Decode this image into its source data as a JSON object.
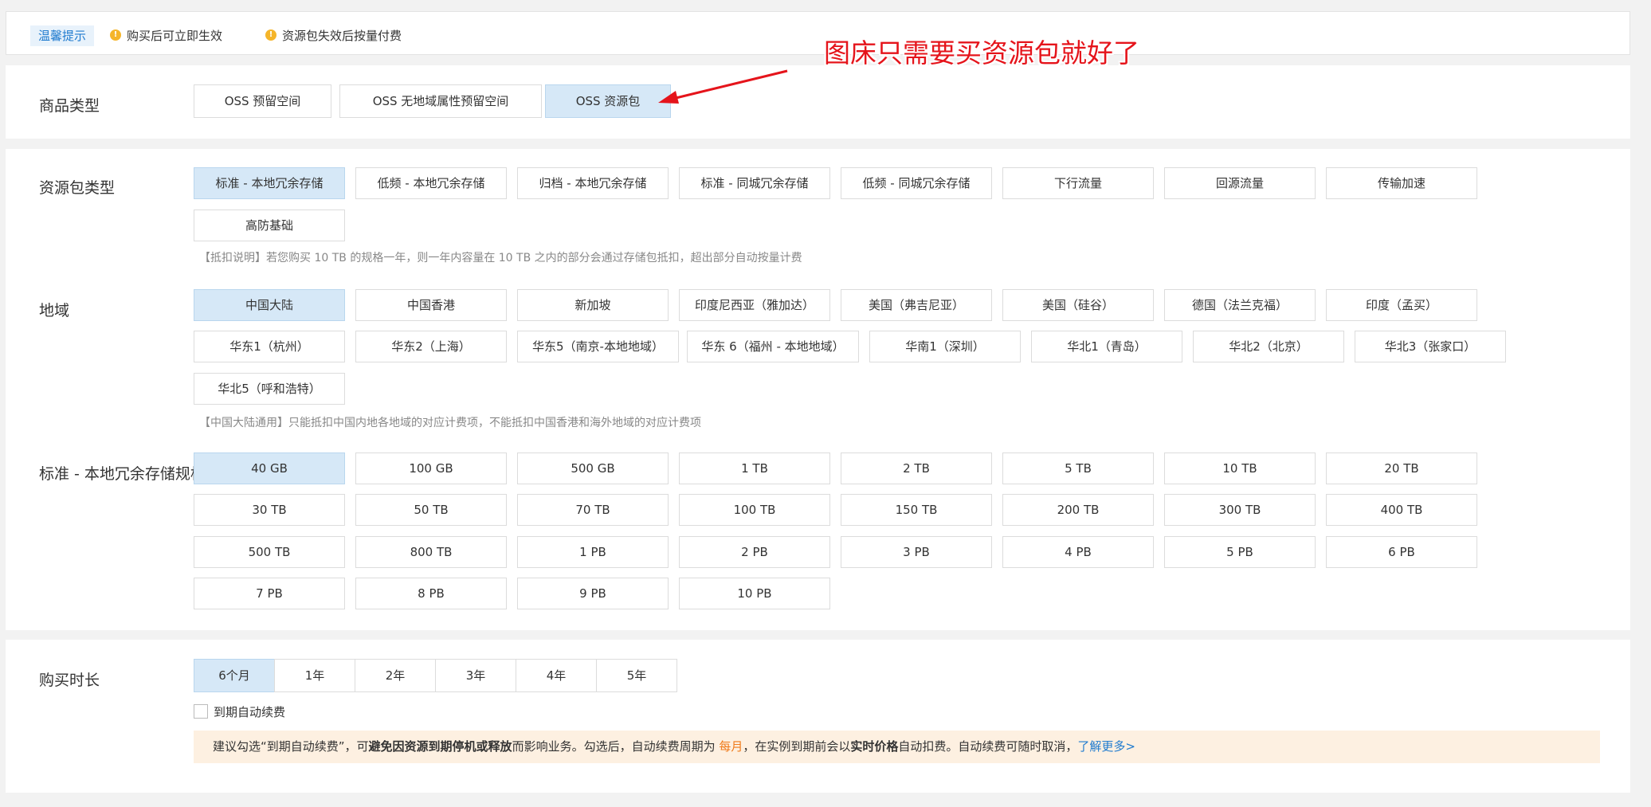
{
  "tips": {
    "badge": "温馨提示",
    "items": [
      "购买后可立即生效",
      "资源包失效后按量付费"
    ]
  },
  "product_type": {
    "label": "商品类型",
    "options": [
      "OSS 预留空间",
      "OSS 无地域属性预留空间",
      "OSS 资源包"
    ],
    "selected": "OSS 资源包"
  },
  "annotation": {
    "text": "图床只需要买资源包就好了",
    "color": "#e5141b"
  },
  "package_type": {
    "label": "资源包类型",
    "options": [
      "标准 - 本地冗余存储",
      "低频 - 本地冗余存储",
      "归档 - 本地冗余存储",
      "标准 - 同城冗余存储",
      "低频 - 同城冗余存储",
      "下行流量",
      "回源流量",
      "传输加速",
      "高防基础"
    ],
    "selected": "标准 - 本地冗余存储",
    "note": "【抵扣说明】若您购买 10 TB 的规格一年，则一年内容量在 10 TB 之内的部分会通过存储包抵扣，超出部分自动按量计费"
  },
  "region": {
    "label": "地域",
    "options": [
      "中国大陆",
      "中国香港",
      "新加坡",
      "印度尼西亚（雅加达）",
      "美国（弗吉尼亚）",
      "美国（硅谷）",
      "德国（法兰克福）",
      "印度（孟买）",
      "华东1（杭州）",
      "华东2（上海）",
      "华东5（南京-本地地域）",
      "华东 6（福州 - 本地地域）",
      "华南1（深圳）",
      "华北1（青岛）",
      "华北2（北京）",
      "华北3（张家口）",
      "华北5（呼和浩特）"
    ],
    "selected": "中国大陆",
    "note": "【中国大陆通用】只能抵扣中国内地各地域的对应计费项，不能抵扣中国香港和海外地域的对应计费项"
  },
  "spec": {
    "label": "标准 - 本地冗余存储规格",
    "options": [
      "40 GB",
      "100 GB",
      "500 GB",
      "1 TB",
      "2 TB",
      "5 TB",
      "10 TB",
      "20 TB",
      "30 TB",
      "50 TB",
      "70 TB",
      "100 TB",
      "150 TB",
      "200 TB",
      "300 TB",
      "400 TB",
      "500 TB",
      "800 TB",
      "1 PB",
      "2 PB",
      "3 PB",
      "4 PB",
      "5 PB",
      "6 PB",
      "7 PB",
      "8 PB",
      "9 PB",
      "10 PB"
    ],
    "selected": "40 GB"
  },
  "duration": {
    "label": "购买时长",
    "options": [
      "6个月",
      "1年",
      "2年",
      "3年",
      "4年",
      "5年"
    ],
    "selected": "6个月",
    "auto_renew_label": "到期自动续费",
    "auto_renew_checked": false
  },
  "advice": {
    "part1": "建议勾选“到期自动续费”，可",
    "bold1": "避免因资源到期停机或释放",
    "part2": "而影响业务。勾选后，自动续费周期为 ",
    "orange": "每月",
    "part3": "，在实例到期前会以",
    "bold2": "实时价格",
    "part4": "自动扣费。自动续费可随时取消，",
    "link": "了解更多>"
  },
  "colors": {
    "selected_bg": "#d6e8f7",
    "link": "#1f7bcf",
    "warn_dot": "#f5b52a",
    "advice_bg": "#fdf0e1"
  }
}
